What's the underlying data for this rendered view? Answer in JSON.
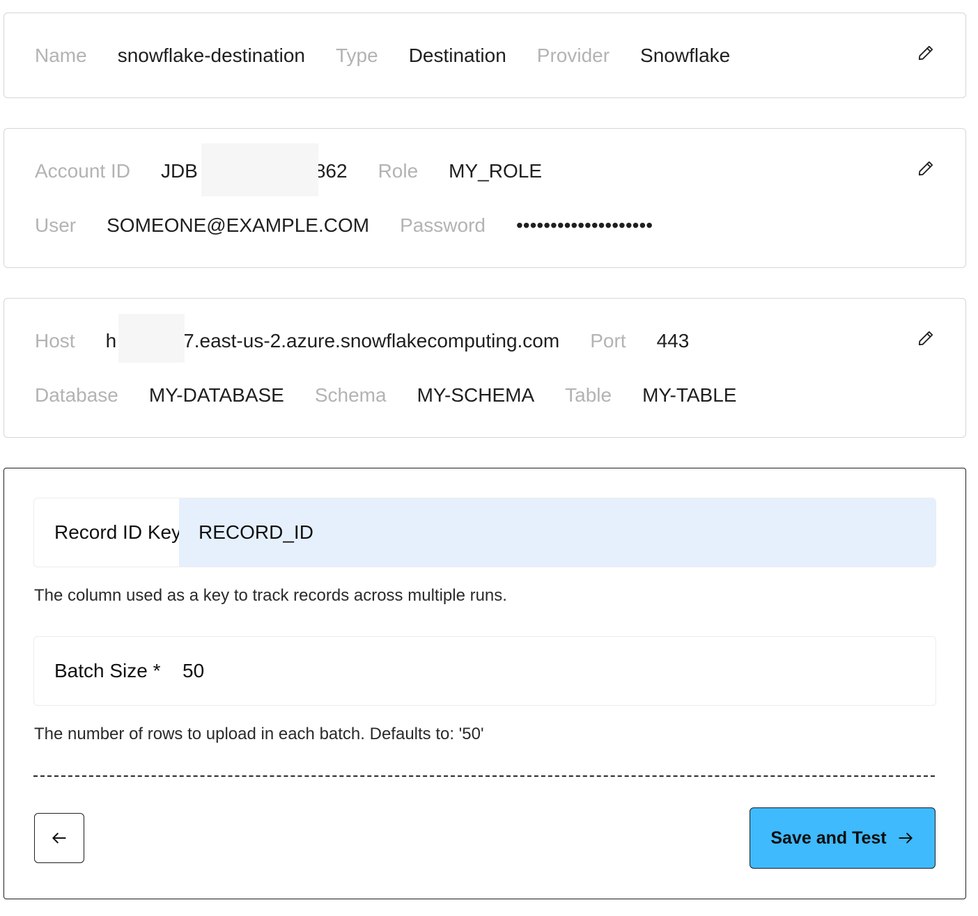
{
  "general": {
    "name_label": "Name",
    "name_value": "snowflake-destination",
    "type_label": "Type",
    "type_value": "Destination",
    "provider_label": "Provider",
    "provider_value": "Snowflake",
    "edit_icon": "pencil-icon"
  },
  "credentials": {
    "account_label": "Account ID",
    "account_value_start": "JDB",
    "account_value_end": "862",
    "role_label": "Role",
    "role_value": "MY_ROLE",
    "user_label": "User",
    "user_value": "SOMEONE@EXAMPLE.COM",
    "password_label": "Password",
    "password_value": "••••••••••••••••••••",
    "edit_icon": "pencil-icon"
  },
  "connection": {
    "host_label": "Host",
    "host_value_start": "h",
    "host_value_end": "7.east-us-2.azure.snowflakecomputing.com",
    "port_label": "Port",
    "port_value": "443",
    "database_label": "Database",
    "database_value": "MY-DATABASE",
    "schema_label": "Schema",
    "schema_value": "MY-SCHEMA",
    "table_label": "Table",
    "table_value": "MY-TABLE",
    "edit_icon": "pencil-icon"
  },
  "form": {
    "record_id_key": {
      "label": "Record ID Key",
      "value": "RECORD_ID",
      "help": "The column used as a key to track records across multiple runs."
    },
    "batch_size": {
      "label": "Batch Size *",
      "value": "50",
      "help": "The number of rows to upload in each batch. Defaults to: '50'"
    },
    "back_icon": "arrow-left-icon",
    "save_label": "Save and Test",
    "save_icon": "arrow-right-icon",
    "colors": {
      "save_button_bg": "#3fbafd",
      "focused_input_bg": "#e6f0fd"
    }
  }
}
